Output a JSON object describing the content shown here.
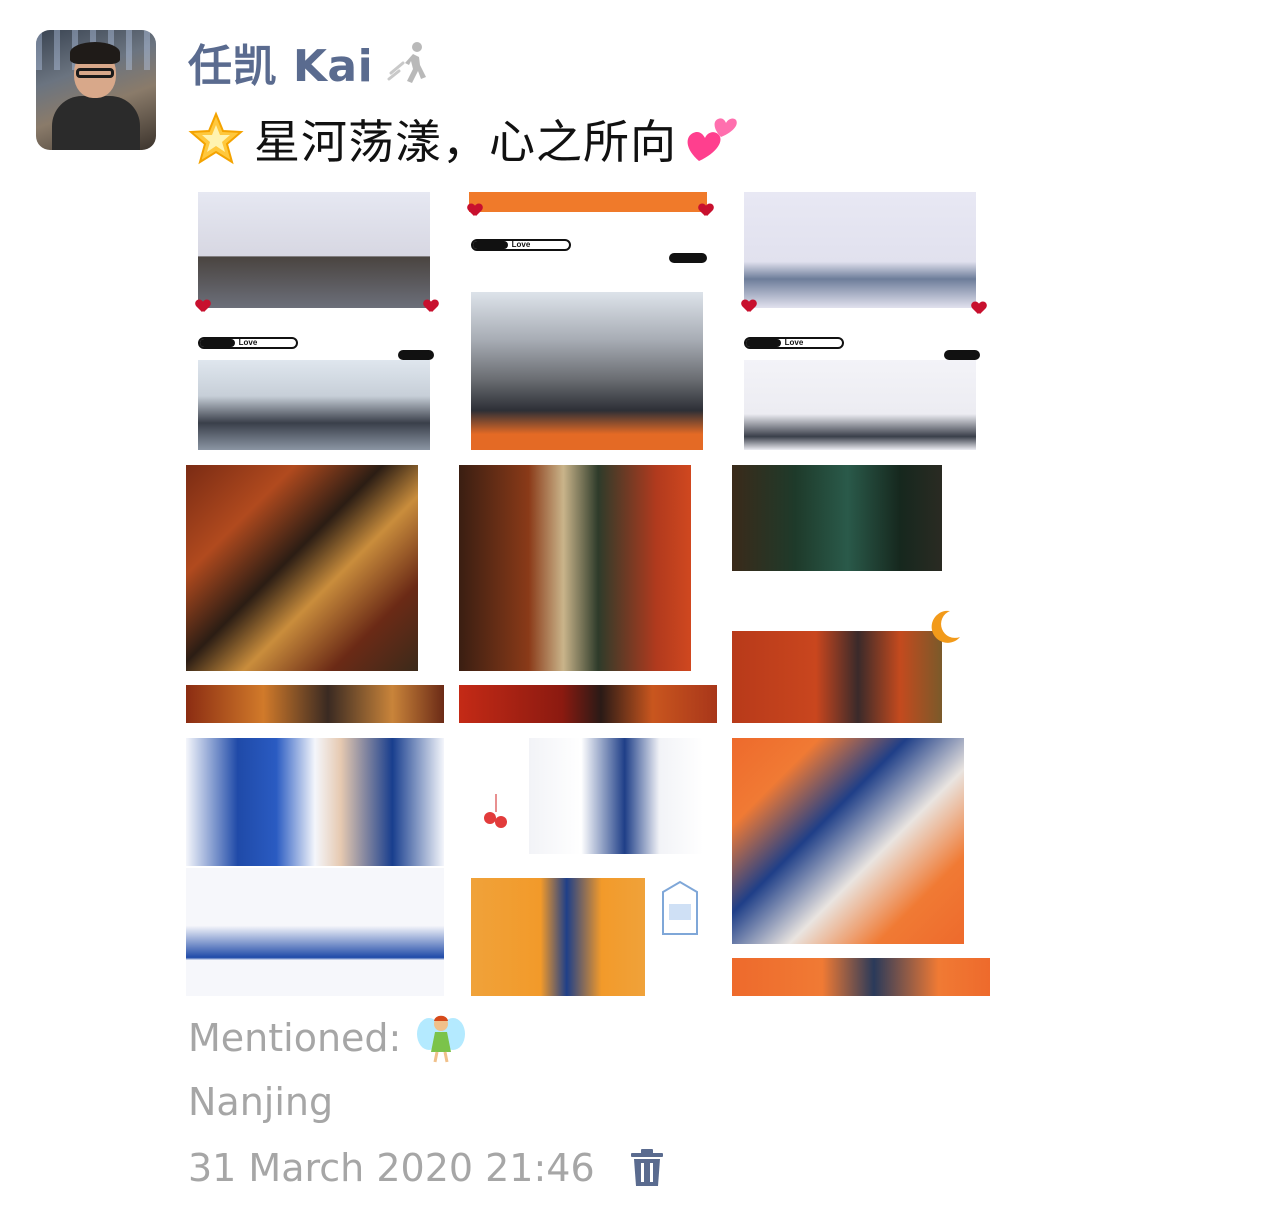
{
  "post": {
    "author_name": "任凯 Kai",
    "caption": "星河荡漾，心之所向",
    "mentioned_label": "Mentioned:",
    "location": "Nanjing",
    "timestamp": "31 March 2020 21:46"
  },
  "icons": {
    "status": "walking-person-icon",
    "caption_start": "glowing-star-emoji",
    "caption_end": "two-hearts-emoji",
    "mentioned_user": "fairy-emoji",
    "delete": "trash-icon"
  },
  "photo_grid": {
    "count": 9,
    "love_label": "Love"
  },
  "colors": {
    "author_name": "#5a6b8f",
    "meta_text": "#a6a6a6",
    "trash_icon": "#5a6b8f"
  }
}
